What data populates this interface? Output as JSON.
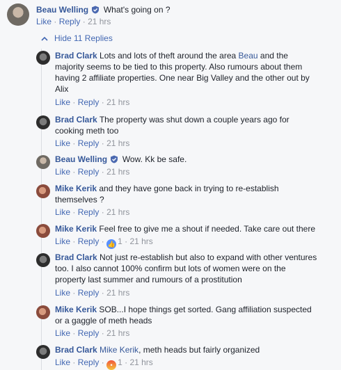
{
  "top_comment": {
    "author": "Beau Welling",
    "text": "What's going on ?",
    "like": "Like",
    "reply": "Reply",
    "sep": "·",
    "time": "21 hrs"
  },
  "hide_replies": "Hide 11 Replies",
  "replies": [
    {
      "author": "Brad Clark",
      "verified": false,
      "avatar": "brad",
      "lines": [
        "Lots and lots of theft around the area ",
        "majority seems to be tied to this property. Also rumours about them",
        "having 2 affiliate properties. One near Big Valley and the other out by",
        "Alix"
      ],
      "tag": "Beau",
      "tag_after": " and the",
      "like": "Like",
      "reply": "Reply",
      "time": "21 hrs",
      "reaction": null
    },
    {
      "author": "Brad Clark",
      "avatar": "brad",
      "lines": [
        "The property was shut down a couple years ago for",
        "cooking meth too"
      ],
      "like": "Like",
      "reply": "Reply",
      "time": "21 hrs"
    },
    {
      "author": "Beau Welling",
      "avatar": "beau",
      "lines": [
        "Wow. Kk be safe."
      ],
      "like": "Like",
      "reply": "Reply",
      "time": "21 hrs"
    },
    {
      "author": "Mike Kerik",
      "avatar": "mike",
      "lines": [
        "and they have gone back in trying to re-establish",
        "themselves ?"
      ],
      "like": "Like",
      "reply": "Reply",
      "time": "21 hrs"
    },
    {
      "author": "Mike Kerik",
      "avatar": "mike",
      "lines": [
        "Feel free to give me a shout if needed. Take care out there"
      ],
      "like": "Like",
      "reply": "Reply",
      "time": "21 hrs",
      "reaction_count": "1"
    },
    {
      "author": "Brad Clark",
      "avatar": "brad",
      "lines": [
        "Not just re-establish but also to expand with other ventures",
        "too. I also cannot 100% confirm but lots of women were on the",
        "property last summer and rumours of a prostitution"
      ],
      "like": "Like",
      "reply": "Reply",
      "time": "21 hrs"
    },
    {
      "author": "Mike Kerik",
      "avatar": "mike",
      "lines": [
        "SOB...I hope things get sorted. Gang affiliation suspected",
        "or a gaggle of meth heads"
      ],
      "like": "Like",
      "reply": "Reply",
      "time": "21 hrs"
    },
    {
      "author": "Brad Clark",
      "avatar": "brad",
      "tag": "Mike Kerik",
      "lines": [
        ", meth heads but fairly organized"
      ],
      "like": "Like",
      "reply": "Reply",
      "time": "21 hrs",
      "reaction_count": "1"
    }
  ],
  "colors": {
    "link": "#365899",
    "action": "#4267b2",
    "meta": "#90949c",
    "background": "#f6f7f9"
  }
}
